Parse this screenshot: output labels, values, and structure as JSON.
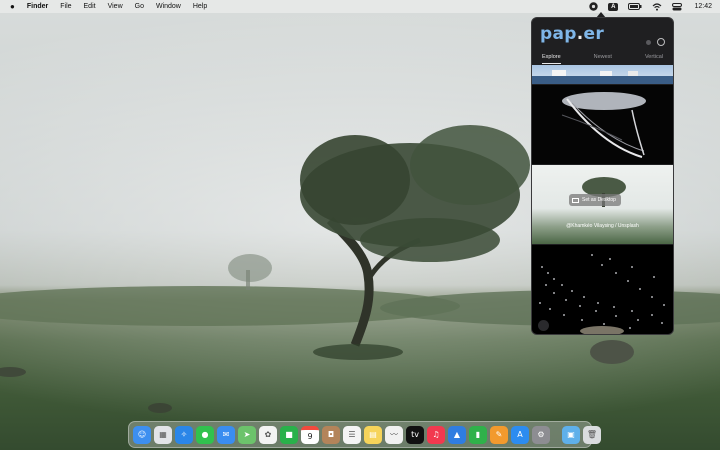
{
  "menubar": {
    "apple": "",
    "app_name": "Finder",
    "menus": [
      "File",
      "Edit",
      "View",
      "Go",
      "Window",
      "Help"
    ],
    "input_source": "A",
    "clock": "12:42"
  },
  "popover": {
    "logo_main": "pap",
    "logo_dot": ".",
    "logo_tail": "er",
    "tabs": [
      "Explore",
      "Newest",
      "Vertical"
    ],
    "active_tab": "Explore",
    "set_button_label": "Set as Desktop",
    "credit": "@Khamkéo Vilaysing / Unsplash"
  },
  "dock": {
    "apps": [
      {
        "name": "finder",
        "color": "#3d8ff0",
        "glyph": "☺"
      },
      {
        "name": "launchpad",
        "color": "#e2e4e8",
        "glyph": "▦"
      },
      {
        "name": "safari",
        "color": "#2a86e8",
        "glyph": "✧"
      },
      {
        "name": "messages",
        "color": "#31c24e",
        "glyph": "●"
      },
      {
        "name": "mail",
        "color": "#3a8df0",
        "glyph": "✉"
      },
      {
        "name": "maps",
        "color": "#6cc36b",
        "glyph": "➤"
      },
      {
        "name": "photos",
        "color": "#f3f3f3",
        "glyph": "✿"
      },
      {
        "name": "facetime",
        "color": "#29b14a",
        "glyph": "■"
      },
      {
        "name": "calendar",
        "color": "#ffffff",
        "glyph": "9"
      },
      {
        "name": "contacts",
        "color": "#b3845a",
        "glyph": "◘"
      },
      {
        "name": "reminders",
        "color": "#f4f4f4",
        "glyph": "☰"
      },
      {
        "name": "notes",
        "color": "#f6d45a",
        "glyph": "▤"
      },
      {
        "name": "freeform",
        "color": "#f1f1f1",
        "glyph": "〰"
      },
      {
        "name": "tv",
        "color": "#111111",
        "glyph": "tv"
      },
      {
        "name": "music",
        "color": "#f2394f",
        "glyph": "♫"
      },
      {
        "name": "keynote",
        "color": "#2f7de1",
        "glyph": "▲"
      },
      {
        "name": "numbers",
        "color": "#2fb24a",
        "glyph": "▮"
      },
      {
        "name": "pages",
        "color": "#f29a2e",
        "glyph": "✎"
      },
      {
        "name": "app-store",
        "color": "#2c8cf0",
        "glyph": "A"
      },
      {
        "name": "system-settings",
        "color": "#8d8d92",
        "glyph": "⚙"
      }
    ],
    "extra": [
      {
        "name": "downloads-folder",
        "color": "#5fb0ea",
        "glyph": "▣"
      },
      {
        "name": "trash",
        "color": "#d9dcde",
        "glyph": "🗑"
      }
    ],
    "calendar_month": "",
    "calendar_day": "9"
  }
}
